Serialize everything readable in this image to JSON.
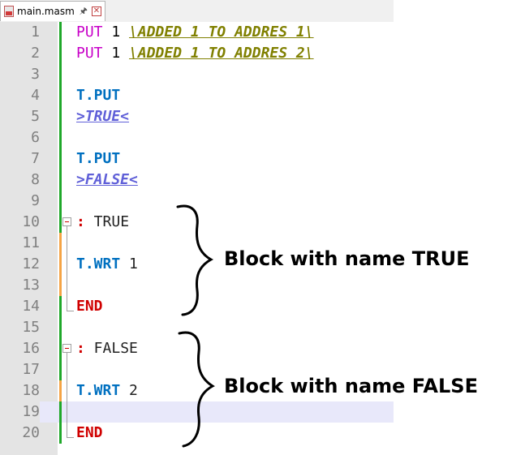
{
  "tab": {
    "label": "main.masm",
    "pin_icon": "pin-icon",
    "close_icon": "close-icon"
  },
  "lines": [
    {
      "n": "1",
      "marker": "green",
      "tokens": [
        {
          "t": "PUT",
          "c": "kw-put"
        },
        {
          "t": " 1 ",
          "c": "num"
        },
        {
          "t": "\\ADDED 1 TO ADDRES 1\\",
          "c": "cmt"
        }
      ]
    },
    {
      "n": "2",
      "marker": "green",
      "tokens": [
        {
          "t": "PUT",
          "c": "kw-put"
        },
        {
          "t": " 1 ",
          "c": "num"
        },
        {
          "t": "\\ADDED 1 TO ADDRES 2\\",
          "c": "cmt"
        }
      ]
    },
    {
      "n": "3",
      "marker": "green",
      "tokens": []
    },
    {
      "n": "4",
      "marker": "green",
      "tokens": [
        {
          "t": "T.PUT",
          "c": "tput"
        }
      ]
    },
    {
      "n": "5",
      "marker": "green",
      "tokens": [
        {
          "t": ">TRUE<",
          "c": "lbl"
        }
      ]
    },
    {
      "n": "6",
      "marker": "green",
      "tokens": []
    },
    {
      "n": "7",
      "marker": "green",
      "tokens": [
        {
          "t": "T.PUT",
          "c": "tput"
        }
      ]
    },
    {
      "n": "8",
      "marker": "green",
      "tokens": [
        {
          "t": ">FALSE<",
          "c": "lbl"
        }
      ]
    },
    {
      "n": "9",
      "marker": "green",
      "tokens": []
    },
    {
      "n": "10",
      "marker": "green",
      "tokens": [
        {
          "t": ":",
          "c": "colon"
        },
        {
          "t": " TRUE",
          "c": "blockname"
        }
      ]
    },
    {
      "n": "11",
      "marker": "orange",
      "tokens": []
    },
    {
      "n": "12",
      "marker": "orange",
      "tokens": [
        {
          "t": "T.WRT",
          "c": "tput"
        },
        {
          "t": " 1",
          "c": "blockname"
        }
      ]
    },
    {
      "n": "13",
      "marker": "orange",
      "tokens": []
    },
    {
      "n": "14",
      "marker": "green",
      "tokens": [
        {
          "t": "END",
          "c": "end"
        }
      ]
    },
    {
      "n": "15",
      "marker": "green",
      "tokens": []
    },
    {
      "n": "16",
      "marker": "green",
      "tokens": [
        {
          "t": ":",
          "c": "colon"
        },
        {
          "t": " FALSE",
          "c": "blockname"
        }
      ]
    },
    {
      "n": "17",
      "marker": "green",
      "tokens": []
    },
    {
      "n": "18",
      "marker": "orange",
      "tokens": [
        {
          "t": "T.WRT",
          "c": "tput"
        },
        {
          "t": " 2",
          "c": "blockname"
        }
      ]
    },
    {
      "n": "19",
      "marker": "green",
      "tokens": [],
      "current": true
    },
    {
      "n": "20",
      "marker": "green",
      "tokens": [
        {
          "t": "END",
          "c": "end"
        }
      ]
    }
  ],
  "annotations": {
    "true_block": "Block with name TRUE",
    "false_block": "Block with name FALSE"
  },
  "colors": {
    "put_keyword": "#c800c8",
    "comment": "#808000",
    "t_command": "#0070c0",
    "label": "#6060d8",
    "end_keyword": "#d00000",
    "change_saved": "#1fa82a",
    "change_unsaved": "#f5a445",
    "current_line": "#e8e8fa"
  }
}
